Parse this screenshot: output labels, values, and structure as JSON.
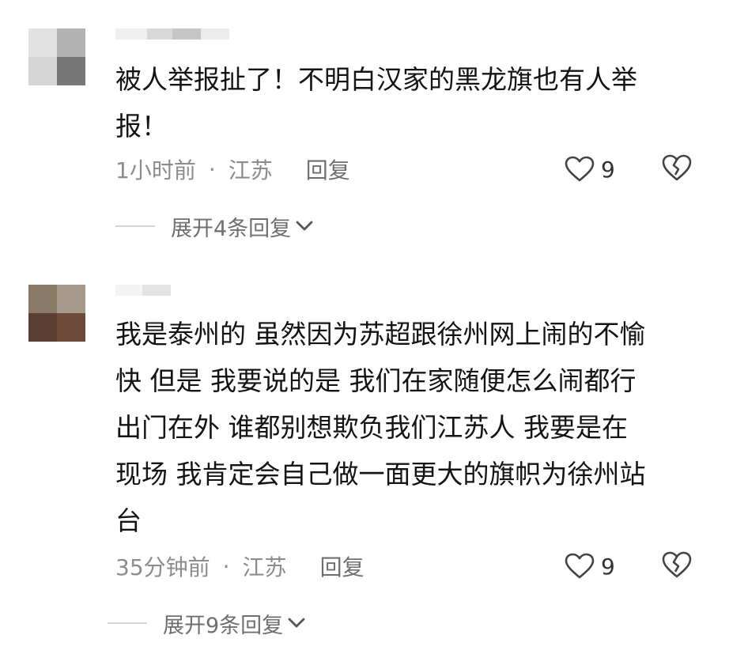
{
  "comments": [
    {
      "text": "被人举报扯了！不明白汉家的黑龙旗也有人举\n报！",
      "time": "1小时前",
      "location": "江苏",
      "reply_label": "回复",
      "likes": "9",
      "expand_label": "展开4条回复"
    },
    {
      "text": "我是泰州的 虽然因为苏超跟徐州网上闹的不愉\n快 但是 我要说的是 我们在家随便怎么闹都行\n出门在外 谁都别想欺负我们江苏人 我要是在\n现场 我肯定会自己做一面更大的旗帜为徐州站\n台",
      "time": "35分钟前",
      "location": "江苏",
      "reply_label": "回复",
      "likes": "9",
      "expand_label": "展开9条回复"
    }
  ],
  "separator": "·",
  "icons": [
    "heart-outline-icon",
    "broken-heart-icon",
    "chevron-down-icon"
  ],
  "colors": {
    "text": "#141414",
    "meta": "#8c8c8c",
    "reply": "#6f6f6f",
    "divider": "#d4d4d4"
  }
}
